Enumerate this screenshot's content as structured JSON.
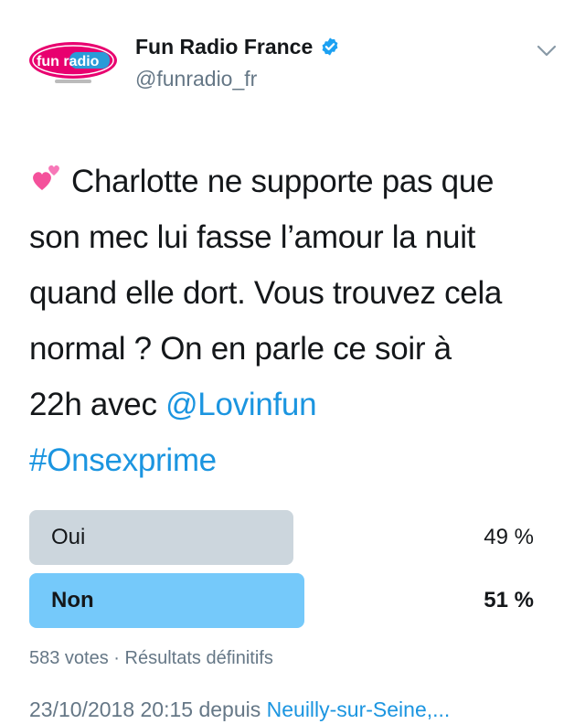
{
  "account": {
    "display_name": "Fun Radio France",
    "handle": "@funradio_fr",
    "avatar_logo_text": "fun radio",
    "verified": true
  },
  "tweet": {
    "emoji": "two-hearts",
    "lines": [
      "Charlotte ne supporte pas que",
      "son mec lui fasse l’amour la nuit",
      "quand elle dort. Vous trouvez cela",
      "normal ? On en parle ce soir à"
    ],
    "line5_prefix": "22h avec ",
    "mention": "@Lovinfun",
    "hashtag": "#Onsexprime"
  },
  "poll": {
    "options": [
      {
        "label": "Oui",
        "percent_text": "49 %",
        "percent": 49,
        "winner": false
      },
      {
        "label": "Non",
        "percent_text": "51 %",
        "percent": 51,
        "winner": true
      }
    ],
    "votes": "583 votes",
    "separator": "·",
    "status": "Résultats définitifs"
  },
  "footer": {
    "timestamp": "23/10/2018 20:15",
    "source_prefix": "depuis",
    "location": "Neuilly-sur-Seine,..."
  },
  "colors": {
    "loser_bar": "#ccd6dd",
    "winner_bar": "#75c9fa",
    "link": "#1b95e0",
    "muted": "#657786",
    "verified": "#1da1f2"
  }
}
